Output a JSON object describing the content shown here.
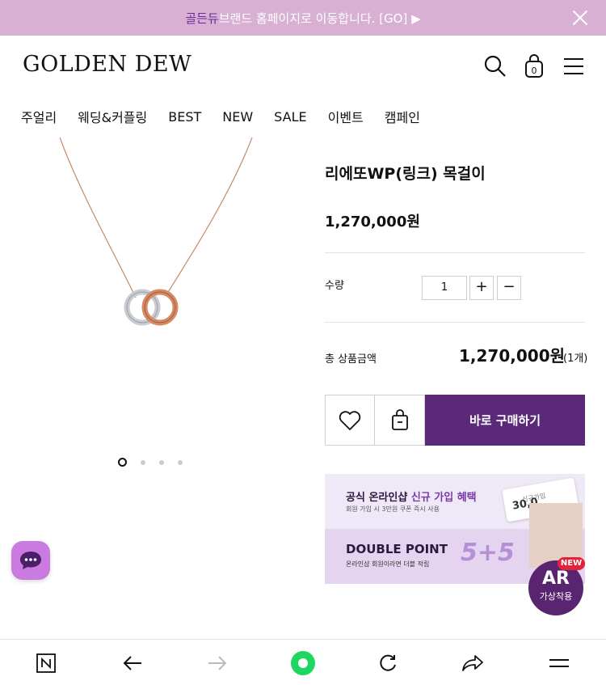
{
  "banner": {
    "brand": "골든듀",
    "message": " 브랜드 홈페이지로 이동합니다. [GO] ▶"
  },
  "header": {
    "logo": "GOLDEN DEW",
    "cart_count": "0"
  },
  "nav": [
    "주얼리",
    "웨딩&커플링",
    "BEST",
    "NEW",
    "SALE",
    "이벤트",
    "캠페인"
  ],
  "product": {
    "name": "리에또WP(링크) 목걸이",
    "price": "1,270,000원",
    "quantity_label": "수량",
    "quantity": "1",
    "plus": "+",
    "minus": "−",
    "total_label": "총 상품금액",
    "total_price": "1,270,000원",
    "total_count": "(1개)",
    "buy_label": "바로 구매하기"
  },
  "carousel": {
    "slides": 4,
    "active": 0
  },
  "promo": {
    "title_pre": "공식 온라인샵 ",
    "title_accent": "신규 가입 혜택",
    "subtitle": "회원 가입 시 3만원 쿠폰 즉시 사용",
    "double_title": "DOUBLE POINT",
    "double_sub": "온라인샵 회원이라면 더블 적립",
    "five_five": "5+5",
    "card_title": "신규가입",
    "card_amount": "30,0"
  },
  "ar": {
    "label": "AR",
    "sub": "가상착용",
    "new": "NEW"
  },
  "colors": {
    "banner_bg": "#d7b0d4",
    "buy_button": "#5a2a78",
    "chat_button": "#c97be0",
    "ar_badge": "#5a2570",
    "new_badge": "#e2233a"
  }
}
